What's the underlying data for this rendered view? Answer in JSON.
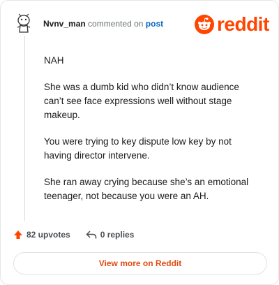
{
  "header": {
    "author": "Nvnv_man",
    "commented_text": "commented on",
    "post_link": "post",
    "brand": "reddit",
    "brand_color": "#ff4500"
  },
  "comment": {
    "paragraphs": [
      "NAH",
      "She was a dumb kid who didn’t know audience can’t see face expressions well without stage makeup.",
      "You were trying to key dispute low key by not having director intervene.",
      "She ran away crying because she’s an emotional teenager, not because you were an AH."
    ]
  },
  "actions": {
    "upvotes": "82 upvotes",
    "replies": "0 replies",
    "upvote_icon": "upvote-arrow-icon",
    "reply_icon": "reply-arrow-icon"
  },
  "footer": {
    "view_more": "View more on Reddit"
  }
}
